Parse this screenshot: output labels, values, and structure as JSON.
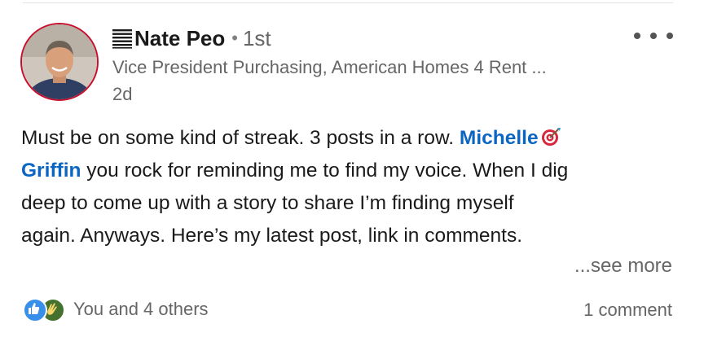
{
  "post": {
    "author": {
      "name": "Nate Peo",
      "degree": "1st",
      "headline": "Vice President Purchasing, American Homes 4 Rent ...",
      "timestamp": "2d",
      "name_icon": "document-lines-icon",
      "avatar": "profile-photo"
    },
    "body": {
      "line1_a": "Must be on some kind of streak. 3 posts in a row. ",
      "mention_first": "Michelle",
      "mention_last": "Griffin",
      "line2_rest": " you rock for reminding me to find my voice. When I dig",
      "line3": "deep to come up with a story to share I’m finding myself",
      "line4": "again. Anyways. Here’s my latest post, link in comments.",
      "emoji": "bullseye-icon"
    },
    "see_more": "...see more",
    "reactions": {
      "icons": [
        "like-icon",
        "clap-icon"
      ],
      "text": "You and 4 others"
    },
    "comments": "1 comment",
    "colors": {
      "mention": "#0a66c2",
      "secondary_text": "#666666",
      "avatar_ring": "#c8102e",
      "like": "#378fe9",
      "clap": "#44712e"
    }
  }
}
